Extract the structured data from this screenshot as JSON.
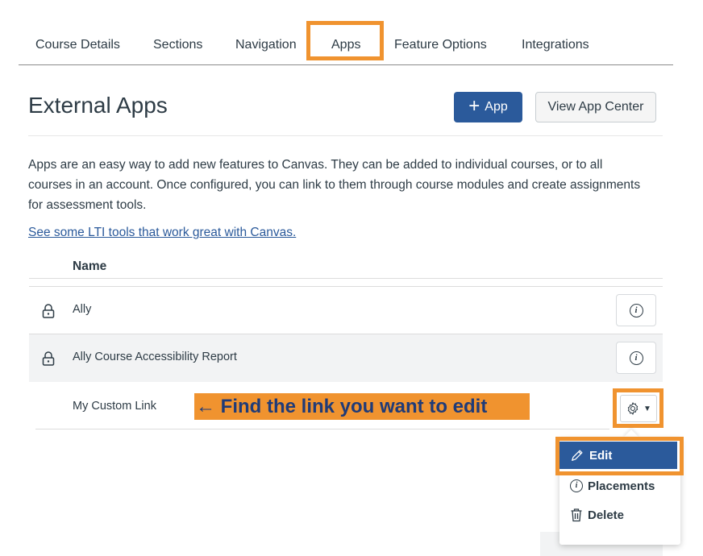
{
  "tabs": [
    "Course Details",
    "Sections",
    "Navigation",
    "Apps",
    "Feature Options",
    "Integrations"
  ],
  "header": {
    "title": "External Apps",
    "add_app_label": "App",
    "view_app_center_label": "View App Center"
  },
  "description": "Apps are an easy way to add new features to Canvas. They can be added to individual courses, or to all courses in an account. Once configured, you can link to them through course modules and create assignments for assessment tools.",
  "lti_link": "See some LTI tools that work great with Canvas.",
  "table": {
    "column_header": "Name",
    "rows": [
      {
        "name": "Ally",
        "locked": true
      },
      {
        "name": "Ally Course Accessibility Report",
        "locked": true
      },
      {
        "name": "My Custom Link",
        "locked": false
      }
    ]
  },
  "annotation": "← Find the link you want to edit",
  "menu": {
    "items": [
      {
        "label": "Edit",
        "icon": "pencil-icon"
      },
      {
        "label": "Placements",
        "icon": "info-icon"
      },
      {
        "label": "Delete",
        "icon": "trash-icon"
      }
    ]
  },
  "colors": {
    "highlight": "#f0932f",
    "primary": "#2b5a9b",
    "annotation_text": "#1f3b78"
  }
}
